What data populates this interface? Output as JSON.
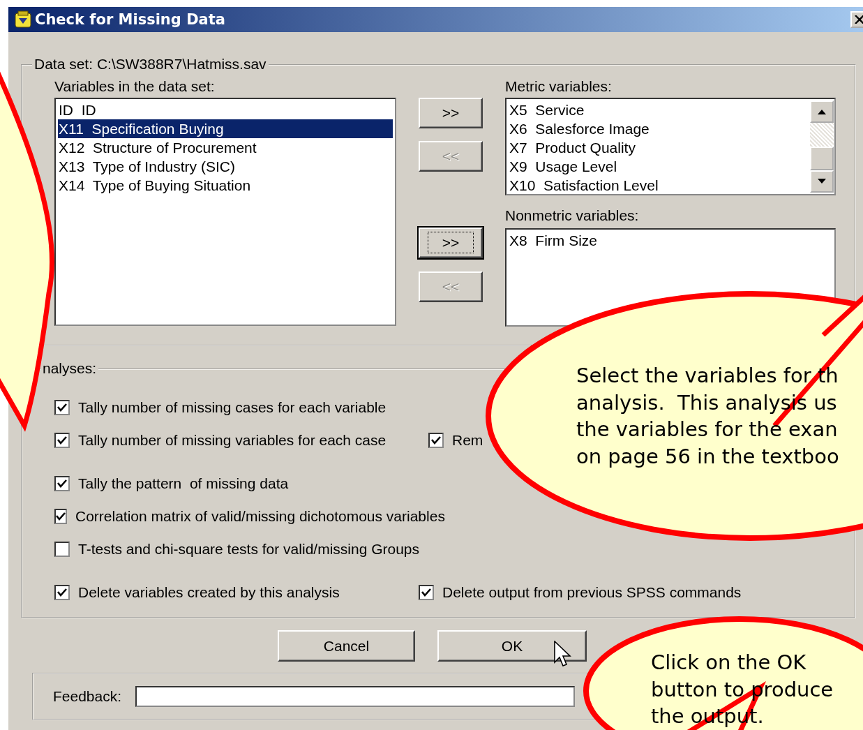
{
  "window": {
    "title": "Check for Missing Data"
  },
  "dataset": {
    "legend": "Data set: C:\\SW388R7\\Hatmiss.sav",
    "source_label": "Variables in the data set:",
    "source_items": [
      {
        "text": "ID  ID",
        "selected": false
      },
      {
        "text": "X11  Specification Buying",
        "selected": true
      },
      {
        "text": "X12  Structure of Procurement",
        "selected": false
      },
      {
        "text": "X13  Type of Industry (SIC)",
        "selected": false
      },
      {
        "text": "X14  Type of Buying Situation",
        "selected": false
      }
    ],
    "move_buttons": [
      {
        "label": ">>",
        "disabled": false,
        "focused": false
      },
      {
        "label": "<<",
        "disabled": true,
        "focused": false
      },
      {
        "label": ">>",
        "disabled": false,
        "focused": true
      },
      {
        "label": "<<",
        "disabled": true,
        "focused": false
      }
    ],
    "metric_label": "Metric variables:",
    "metric_items": [
      {
        "text": "X5  Service",
        "selected": false
      },
      {
        "text": "X6  Salesforce Image",
        "selected": false
      },
      {
        "text": "X7  Product Quality",
        "selected": false
      },
      {
        "text": "X9  Usage Level",
        "selected": false
      },
      {
        "text": "X10  Satisfaction Level",
        "selected": false
      }
    ],
    "nonmetric_label": "Nonmetric variables:",
    "nonmetric_items": [
      {
        "text": "X8  Firm Size",
        "selected": false
      }
    ]
  },
  "analyses": {
    "legend": "nalyses:",
    "rows": [
      {
        "options": [
          {
            "label": "Tally number of missing cases for each variable",
            "checked": true
          }
        ]
      },
      {
        "options": [
          {
            "label": "Tally number of missing variables for each case",
            "checked": true
          },
          {
            "label": "Rem",
            "checked": true
          }
        ]
      },
      {
        "options": [
          {
            "label": "Tally the pattern  of missing data",
            "checked": true
          }
        ]
      },
      {
        "options": [
          {
            "label": "Correlation matrix of valid/missing dichotomous variables",
            "checked": true
          }
        ]
      },
      {
        "options": [
          {
            "label": "T-tests and chi-square tests for valid/missing Groups",
            "checked": false
          }
        ]
      },
      {
        "options": [
          {
            "label": "Delete variables created by this analysis",
            "checked": true
          },
          {
            "label": "Delete output from previous SPSS commands",
            "checked": true
          }
        ]
      }
    ]
  },
  "buttons": [
    {
      "label": "Cancel"
    },
    {
      "label": "OK"
    }
  ],
  "feedback": {
    "label": "Feedback:"
  },
  "callouts": [
    {
      "kind": "left"
    },
    {
      "kind": "right",
      "lines": [
        "Select the variables for th",
        "analysis.  This analysis us",
        "the variables for the exan",
        "on page 56 in the textboo"
      ]
    },
    {
      "kind": "bottom",
      "lines": [
        "Click on the OK",
        "button to produce",
        "the output."
      ]
    }
  ]
}
